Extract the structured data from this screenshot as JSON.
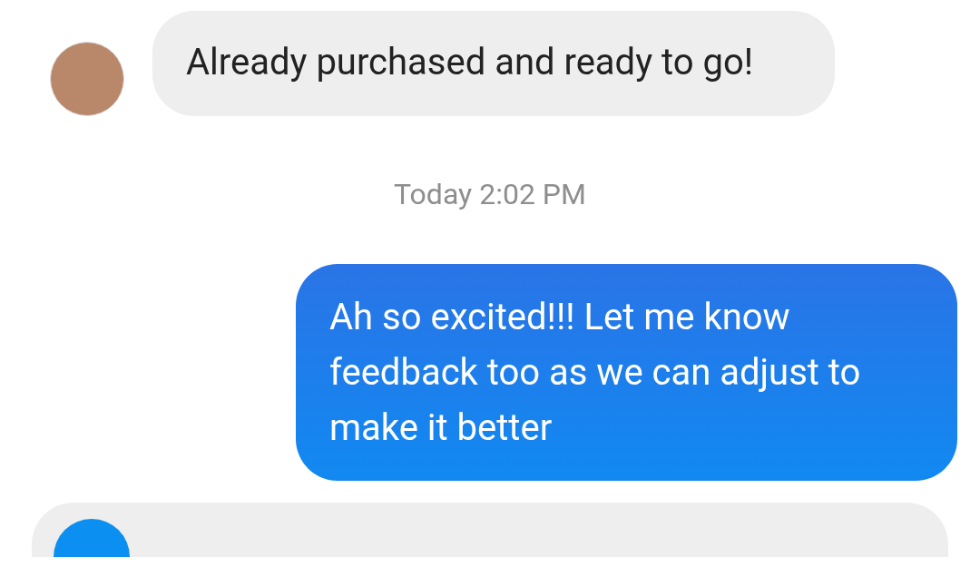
{
  "messages": [
    {
      "kind": "incoming",
      "text": "Already purchased and ready to go!"
    },
    {
      "kind": "timestamp",
      "text": "Today 2:02 PM"
    },
    {
      "kind": "outgoing",
      "text": "Ah so excited!!! Let me know feedback too as we can adjust to make it better"
    }
  ]
}
